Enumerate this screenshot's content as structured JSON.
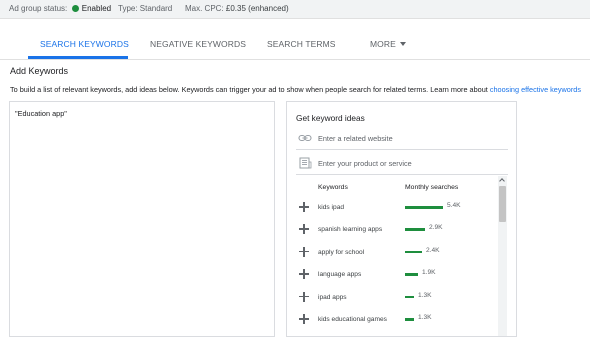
{
  "status": {
    "ad_group_status_label": "Ad group status:",
    "ad_group_status_value": "Enabled",
    "type_text": "Type: Standard",
    "max_cpc_label": "Max. CPC:",
    "max_cpc_value": "£0.35",
    "max_cpc_note": "(enhanced)",
    "status_color": "#1e8e3e"
  },
  "tabs": [
    {
      "label": "SEARCH KEYWORDS",
      "active": true
    },
    {
      "label": "NEGATIVE KEYWORDS",
      "active": false
    },
    {
      "label": "SEARCH TERMS",
      "active": false
    },
    {
      "label": "MORE",
      "active": false
    }
  ],
  "accent_color": "#1a73e8",
  "add_keywords": {
    "title": "Add Keywords",
    "description": "To build a list of relevant keywords, add ideas below. Keywords can trigger your ad to show when people search for related terms. Learn more about",
    "link_text": "choosing effective keywords",
    "textarea_value": "\"Education app\""
  },
  "ideas": {
    "title": "Get keyword ideas",
    "website_placeholder": "Enter a related website",
    "website_icon": "link-icon",
    "product_placeholder": "Enter your product or service",
    "product_icon": "store-icon",
    "col_keywords": "Keywords",
    "col_monthly": "Monthly searches",
    "rows": [
      {
        "keyword": "kids ipad",
        "searches": "5.4K",
        "value": 5400
      },
      {
        "keyword": "spanish learning apps",
        "searches": "2.9K",
        "value": 2900
      },
      {
        "keyword": "apply for school",
        "searches": "2.4K",
        "value": 2400
      },
      {
        "keyword": "language apps",
        "searches": "1.9K",
        "value": 1900
      },
      {
        "keyword": "ipad apps",
        "searches": "1.3K",
        "value": 1300
      },
      {
        "keyword": "kids educational games",
        "searches": "1.3K",
        "value": 1300
      }
    ]
  }
}
